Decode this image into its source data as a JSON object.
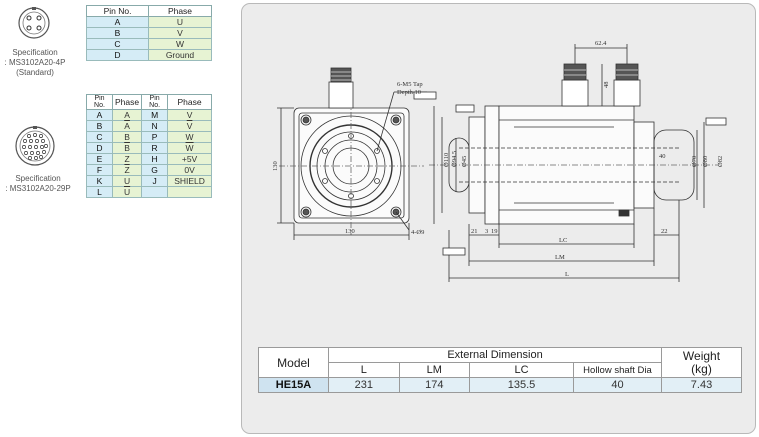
{
  "connector_4p": {
    "caption_line1": "Specification",
    "caption_line2": ": MS3102A20-4P",
    "caption_line3": "(Standard)",
    "headers": [
      "Pin No.",
      "Phase"
    ],
    "rows": [
      {
        "pin": "A",
        "phase": "U"
      },
      {
        "pin": "B",
        "phase": "V"
      },
      {
        "pin": "C",
        "phase": "W"
      },
      {
        "pin": "D",
        "phase": "Ground"
      }
    ]
  },
  "connector_29p": {
    "caption_line1": "Specification",
    "caption_line2": ": MS3102A20-29P",
    "headers": [
      "Pin No.",
      "Phase",
      "Pin No.",
      "Phase"
    ],
    "rows": [
      {
        "pin1": "A",
        "phase1": "A",
        "pin2": "M",
        "phase2": "V"
      },
      {
        "pin1": "B",
        "phase1": "A",
        "pin2": "N",
        "phase2": "V"
      },
      {
        "pin1": "C",
        "phase1": "B",
        "pin2": "P",
        "phase2": "W"
      },
      {
        "pin1": "D",
        "phase1": "B",
        "pin2": "R",
        "phase2": "W"
      },
      {
        "pin1": "E",
        "phase1": "Z",
        "pin2": "H",
        "phase2": "+5V"
      },
      {
        "pin1": "F",
        "phase1": "Z",
        "pin2": "G",
        "phase2": "0V"
      },
      {
        "pin1": "K",
        "phase1": "U",
        "pin2": "J",
        "phase2": "SHIELD"
      },
      {
        "pin1": "L",
        "phase1": "U",
        "pin2": "",
        "phase2": ""
      }
    ]
  },
  "drawing": {
    "tap_label": "6-M5 Tap",
    "depth_label": "Depth 10",
    "hole_label": "4-Ø9",
    "dim_130_side": "130",
    "dim_130_bottom": "130",
    "dim_62_4": "62.4",
    "dim_48": "48",
    "dim_21": "21",
    "dim_3": "3",
    "dim_19": "19",
    "dim_40": "40",
    "dim_22": "22",
    "dim_lc": "LC",
    "dim_lm": "LM",
    "dim_l": "L",
    "dim_d1": "Ø110",
    "dim_d2": "Ø94.5",
    "dim_d3": "Ø45",
    "dim_d4": "Ø70",
    "dim_d5": "Ø80",
    "dim_d6": "Ø82"
  },
  "dimensions_table": {
    "model_header": "Model",
    "external_header": "External Dimension",
    "weight_header": "Weight",
    "weight_unit": "(kg)",
    "sub_headers": [
      "L",
      "LM",
      "LC",
      "Hollow shaft Dia"
    ],
    "rows": [
      {
        "model": "HE15A",
        "L": "231",
        "LM": "174",
        "LC": "135.5",
        "hollow": "40",
        "weight": "7.43"
      }
    ]
  }
}
